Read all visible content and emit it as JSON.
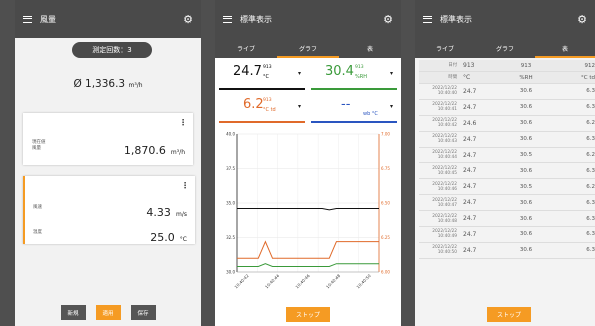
{
  "phone1": {
    "title": "風量",
    "count_pill": "測定回数：3",
    "main_value": "Ø 1,336.3",
    "main_unit": "m³/h",
    "card1": {
      "label_line1": "現在値",
      "label_line2": "風量",
      "value": "1,870.6",
      "unit": "m³/h"
    },
    "card2": {
      "row1": {
        "label": "風速",
        "value": "4.33",
        "unit": "m/s"
      },
      "row2": {
        "label": "温度",
        "value": "25.0",
        "unit": "°C"
      }
    },
    "buttons": {
      "new": "新規",
      "apply": "適用",
      "save": "保存"
    }
  },
  "phone2": {
    "title": "標準表示",
    "tabs": [
      "ライブ",
      "グラフ",
      "表"
    ],
    "active_tab": 1,
    "meas": [
      {
        "value": "24.7",
        "sup": "913",
        "unit": "°C",
        "color": "#111111",
        "border": "#111111"
      },
      {
        "value": "30.4",
        "sup": "913",
        "unit": "%RH",
        "color": "#3a9a3a",
        "border": "#3a9a3a"
      },
      {
        "value": "6.2",
        "sup": "913",
        "unit": "°C td",
        "color": "#e06a2a",
        "border": "#e06a2a"
      },
      {
        "value": "--",
        "sup": "",
        "unit": "wb °C",
        "color": "#2a55c0",
        "border": "#2a55c0"
      }
    ],
    "stop_label": "ストップ",
    "chart_data": {
      "type": "line",
      "left_axis": {
        "ticks": [
          "40.0",
          "37.5",
          "35.0",
          "32.5",
          "30.0"
        ],
        "color": "#222222"
      },
      "right_axis": {
        "ticks": [
          "7.00",
          "6.75",
          "6.50",
          "6.25",
          "6.00"
        ],
        "color": "#e06a2a"
      },
      "left_range": [
        30.0,
        40.0
      ],
      "right_range": [
        6.0,
        7.0
      ],
      "x_ticks": [
        "10:40:42",
        "10:40:44",
        "10:40:46",
        "10:40:48",
        "10:40:50"
      ],
      "series": [
        {
          "color": "#111111",
          "axis": "left",
          "x": [
            0,
            1,
            2,
            3,
            4,
            5,
            6,
            7,
            8,
            9,
            10,
            11,
            12,
            13,
            14,
            15,
            16,
            17,
            18,
            19,
            20
          ],
          "y": [
            34.6,
            34.6,
            34.6,
            34.6,
            34.6,
            34.6,
            34.6,
            34.6,
            34.6,
            34.6,
            34.6,
            34.6,
            34.6,
            34.5,
            34.6,
            34.6,
            34.6,
            34.6,
            34.6,
            34.6,
            34.6
          ]
        },
        {
          "color": "#e06a2a",
          "axis": "right",
          "x": [
            0,
            1,
            2,
            3,
            4,
            5,
            6,
            7,
            8,
            9,
            10,
            11,
            12,
            13,
            14,
            15,
            16,
            17,
            18,
            19,
            20
          ],
          "y": [
            6.1,
            6.1,
            6.1,
            6.1,
            6.22,
            6.1,
            6.1,
            6.1,
            6.1,
            6.1,
            6.1,
            6.1,
            6.1,
            6.1,
            6.22,
            6.22,
            6.22,
            6.22,
            6.22,
            6.22,
            6.22
          ]
        },
        {
          "color": "#3a9a3a",
          "axis": "left",
          "x": [
            0,
            1,
            2,
            3,
            4,
            5,
            6,
            7,
            8,
            9,
            10,
            11,
            12,
            13,
            14,
            15,
            16,
            17,
            18,
            19,
            20
          ],
          "y": [
            30.4,
            30.4,
            30.4,
            30.4,
            30.6,
            30.4,
            30.4,
            30.4,
            30.4,
            30.4,
            30.4,
            30.4,
            30.4,
            30.4,
            30.6,
            30.6,
            30.6,
            30.6,
            30.6,
            30.6,
            30.6
          ]
        }
      ]
    }
  },
  "phone3": {
    "title": "標準表示",
    "tabs": [
      "ライブ",
      "グラフ",
      "表"
    ],
    "active_tab": 2,
    "header_rows": [
      [
        "日付",
        "913",
        "913",
        "912"
      ],
      [
        "時間",
        "°C",
        "%RH",
        "°C td"
      ]
    ],
    "rows": [
      [
        "2022/12/22 10:40:40",
        "24.7",
        "30.6",
        "6.3"
      ],
      [
        "2022/12/22 10:40:41",
        "24.7",
        "30.6",
        "6.3"
      ],
      [
        "2022/12/22 10:40:42",
        "24.6",
        "30.6",
        "6.2"
      ],
      [
        "2022/12/22 10:40:43",
        "24.7",
        "30.6",
        "6.3"
      ],
      [
        "2022/12/22 10:40:44",
        "24.7",
        "30.5",
        "6.2"
      ],
      [
        "2022/12/22 10:40:45",
        "24.7",
        "30.6",
        "6.3"
      ],
      [
        "2022/12/22 10:40:46",
        "24.7",
        "30.5",
        "6.2"
      ],
      [
        "2022/12/22 10:40:47",
        "24.7",
        "30.6",
        "6.3"
      ],
      [
        "2022/12/22 10:40:48",
        "24.7",
        "30.6",
        "6.3"
      ],
      [
        "2022/12/22 10:40:49",
        "24.7",
        "30.6",
        "6.3"
      ],
      [
        "2022/12/22 10:40:50",
        "24.7",
        "30.6",
        "6.3"
      ]
    ],
    "stop_label": "ストップ"
  }
}
